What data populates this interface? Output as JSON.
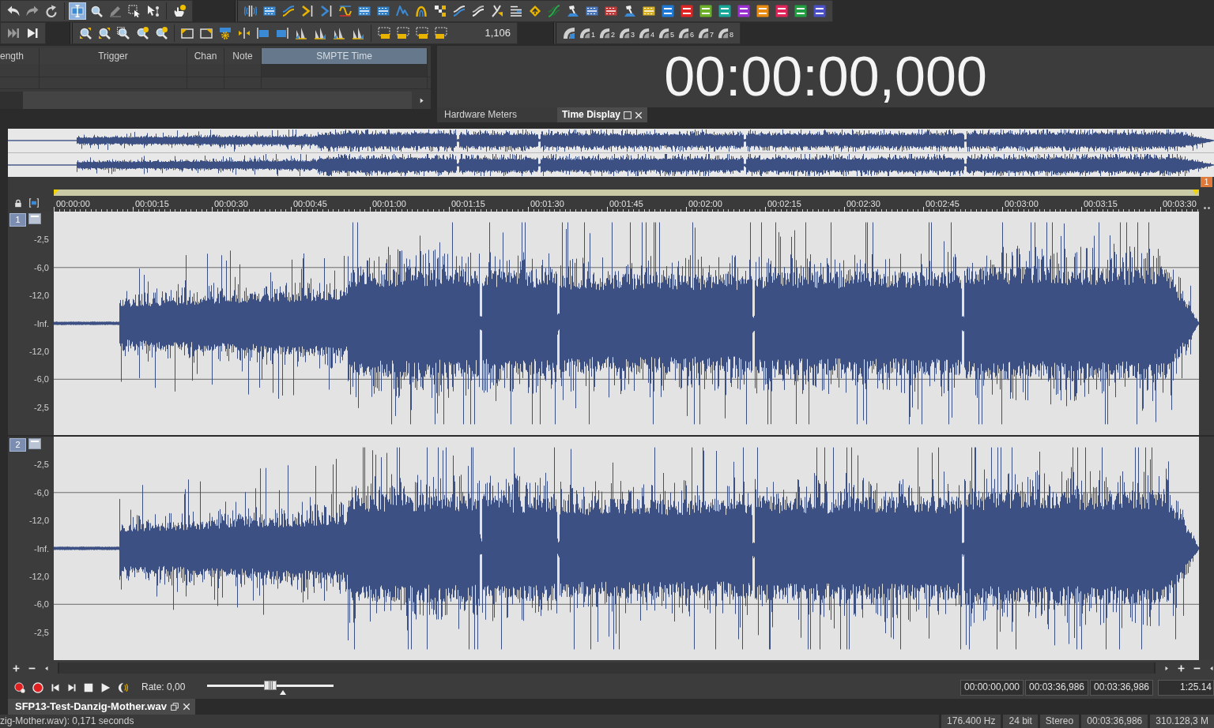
{
  "toolbar": {
    "edit_tools": [
      {
        "selected": true
      },
      {
        "selected": false
      },
      {
        "selected": false
      },
      {
        "selected": false
      },
      {
        "selected": false
      }
    ],
    "zoom_ratio": "1,106",
    "preset_buttons": [
      "1",
      "2",
      "3",
      "4",
      "5",
      "6",
      "7",
      "8"
    ]
  },
  "region_list": {
    "columns": [
      {
        "label": "ength",
        "selected": false
      },
      {
        "label": "Trigger",
        "selected": false
      },
      {
        "label": "Chan",
        "selected": false
      },
      {
        "label": "Note",
        "selected": false
      },
      {
        "label": "SMPTE Time",
        "selected": true
      }
    ]
  },
  "time_display": {
    "value": "00:00:00,000"
  },
  "panel_tabs": [
    {
      "label": "Hardware Meters",
      "selected": false
    },
    {
      "label": "Time Display",
      "selected": true
    }
  ],
  "ruler": {
    "marker": "1",
    "ticks": [
      "00:00:00",
      "00:00:15",
      "00:00:30",
      "00:00:45",
      "00:01:00",
      "00:01:15",
      "00:01:30",
      "00:01:45",
      "00:02:00",
      "00:02:15",
      "00:02:30",
      "00:02:45",
      "00:03:00",
      "00:03:15",
      "00:03:30"
    ]
  },
  "channels": [
    {
      "number": "1",
      "scale": [
        "-2,5",
        "-6,0",
        "-12,0",
        "-Inf.",
        "-12,0",
        "-6,0",
        "-2,5"
      ]
    },
    {
      "number": "2",
      "scale": [
        "-2,5",
        "-6,0",
        "-12,0",
        "-Inf.",
        "-12,0",
        "-6,0",
        "-2,5"
      ]
    }
  ],
  "transport": {
    "rate": "Rate: 0,00",
    "rate_slider": {
      "level": 0.5
    },
    "times": [
      "00:00:00,000",
      "00:03:36,986",
      "00:03:36,986",
      "1:25.14"
    ]
  },
  "document_tab": {
    "title": "SFP13-Test-Danzig-Mother.wav"
  },
  "status_bar": {
    "message": "zig-Mother.wav): 0,171 seconds",
    "fields": [
      "176.400 Hz",
      "24 bit",
      "Stereo",
      "00:03:36,986",
      "310.128,3 M"
    ]
  }
}
